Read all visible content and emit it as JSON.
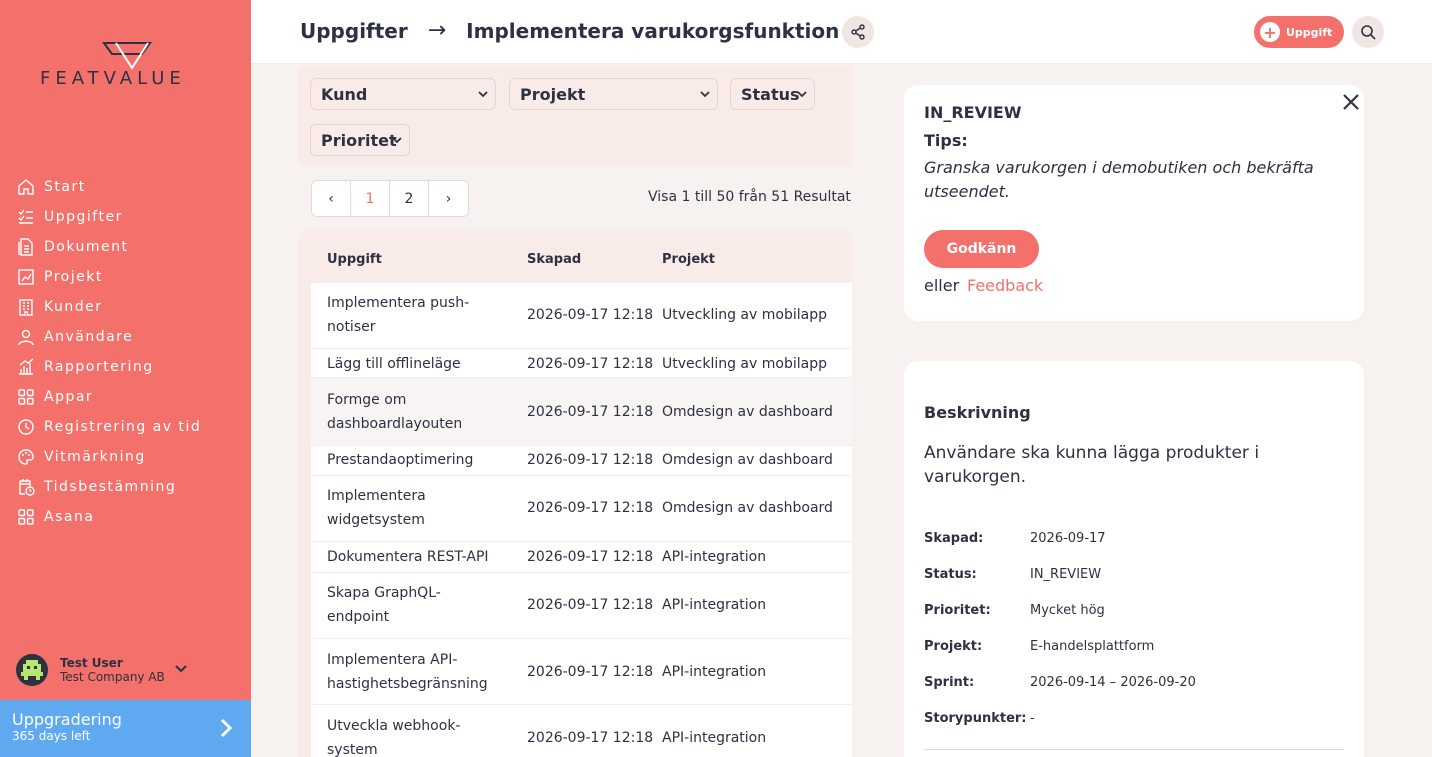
{
  "sidebar": {
    "logo_text": "FEATVALUE",
    "items": [
      {
        "label": "Start",
        "icon": "home-icon"
      },
      {
        "label": "Uppgifter",
        "icon": "checklist-icon"
      },
      {
        "label": "Dokument",
        "icon": "document-icon"
      },
      {
        "label": "Projekt",
        "icon": "project-icon"
      },
      {
        "label": "Kunder",
        "icon": "building-icon"
      },
      {
        "label": "Användare",
        "icon": "user-icon"
      },
      {
        "label": "Rapportering",
        "icon": "chart-icon"
      },
      {
        "label": "Appar",
        "icon": "apps-icon"
      },
      {
        "label": "Registrering av tid",
        "icon": "clock-icon"
      },
      {
        "label": "Vitmärkning",
        "icon": "palette-icon"
      },
      {
        "label": "Tidsbestämning",
        "icon": "calendar-clock-icon"
      },
      {
        "label": "Asana",
        "icon": "apps-icon"
      }
    ],
    "user": {
      "name": "Test User",
      "company": "Test Company AB"
    },
    "upgrade": {
      "title": "Uppgradering",
      "subtitle": "365 days left"
    }
  },
  "header": {
    "crumb_root": "Uppgifter",
    "crumb_arrow": "→",
    "crumb_current": "Implementera varukorgsfunktion",
    "add_label": "Uppgift"
  },
  "filters": {
    "kund": "Kund",
    "projekt": "Projekt",
    "status": "Status",
    "prioritet": "Prioritet"
  },
  "pagination": {
    "prev": "‹",
    "pages": [
      "1",
      "2"
    ],
    "next": "›",
    "summary": "Visa 1 till 50 från 51 Resultat"
  },
  "table": {
    "headers": {
      "task": "Uppgift",
      "created": "Skapad",
      "project": "Projekt"
    },
    "rows": [
      {
        "task": "Implementera push-notiser",
        "created": "2026-09-17 12:18",
        "project": "Utveckling av mobilapp"
      },
      {
        "task": "Lägg till offlineläge",
        "created": "2026-09-17 12:18",
        "project": "Utveckling av mobilapp"
      },
      {
        "task": "Formge om dashboardlayouten",
        "created": "2026-09-17 12:18",
        "project": "Omdesign av dashboard"
      },
      {
        "task": "Prestandaoptimering",
        "created": "2026-09-17 12:18",
        "project": "Omdesign av dashboard"
      },
      {
        "task": "Implementera widgetsystem",
        "created": "2026-09-17 12:18",
        "project": "Omdesign av dashboard"
      },
      {
        "task": "Dokumentera REST-API",
        "created": "2026-09-17 12:18",
        "project": "API-integration"
      },
      {
        "task": "Skapa GraphQL-endpoint",
        "created": "2026-09-17 12:18",
        "project": "API-integration"
      },
      {
        "task": "Implementera API-hastighetsbegränsning",
        "created": "2026-09-17 12:18",
        "project": "API-integration"
      },
      {
        "task": "Utveckla webhook-system",
        "created": "2026-09-17 12:18",
        "project": "API-integration"
      }
    ]
  },
  "review": {
    "status": "IN_REVIEW",
    "tips_label": "Tips:",
    "tips_text": "Granska varukorgen i demobutiken och bekräfta utseendet.",
    "approve": "Godkänn",
    "or": "eller",
    "feedback": "Feedback"
  },
  "description": {
    "heading": "Beskrivning",
    "text": "Användare ska kunna lägga produkter i varukorgen.",
    "meta": [
      {
        "label": "Skapad:",
        "value": "2026-09-17"
      },
      {
        "label": "Status:",
        "value": "IN_REVIEW"
      },
      {
        "label": "Prioritet:",
        "value": "Mycket hög"
      },
      {
        "label": "Projekt:",
        "value": "E-handelsplattform"
      },
      {
        "label": "Sprint:",
        "value": "2026-09-14 – 2026-09-20"
      },
      {
        "label": "Storypunkter:",
        "value": "-"
      }
    ]
  },
  "colors": {
    "accent": "#f3716a",
    "upgrade": "#5fa9f1",
    "text": "#2d3142"
  }
}
